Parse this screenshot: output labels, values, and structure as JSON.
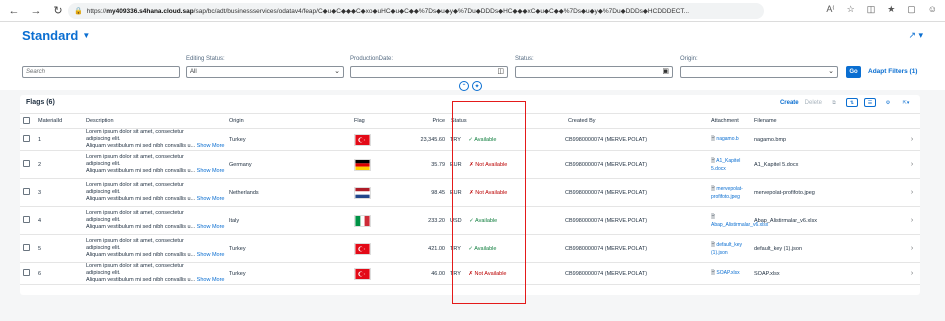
{
  "browser": {
    "url_host": "my409336.s4hana.cloud.sap",
    "url_path": "/sap/bc/adt/businessservices/odatav4/feap/C◆u◆C◆◆◆C◆xo◆uHC◆u◆C◆◆%7Ds◆u◆y◆%7Du◆DDDs◆HC◆◆◆xC◆u◆C◆◆%7Ds◆u◆y◆%7Du◆DDDs◆HCDDDECT..."
  },
  "header": {
    "title": "Standard"
  },
  "filters": {
    "search_placeholder": "Search",
    "editing_status_label": "Editing Status:",
    "editing_status_value": "All",
    "production_date_label": "ProductionDate:",
    "status_label": "Status:",
    "origin_label": "Origin:",
    "go_label": "Go",
    "adapt_label": "Adapt Filters (1)"
  },
  "table": {
    "title": "Flags (6)",
    "create_label": "Create",
    "delete_label": "Delete",
    "columns": [
      "MaterialId",
      "Description",
      "Origin",
      "Flag",
      "Price",
      "Status",
      "Created By",
      "Attachment",
      "Filename"
    ],
    "show_more": "Show More",
    "rows": [
      {
        "id": "1",
        "desc1": "Lorem ipsum dolor sit amet, consectetur",
        "desc2": "adipiscing elit.",
        "desc3": "Aliquam vestibulum mi sed nibh convallis u...",
        "origin": "Turkey",
        "flag": "turkey",
        "price": "23,345.60",
        "currency": "TRY",
        "status": "Available",
        "available": true,
        "created_by": "CB9980000074 (MERVE.POLAT)",
        "attachment": "nagamo.b",
        "filename": "nagamo.bmp"
      },
      {
        "id": "2",
        "desc1": "Lorem ipsum dolor sit amet, consectetur",
        "desc2": "adipiscing elit.",
        "desc3": "Aliquam vestibulum mi sed nibh convallis u...",
        "origin": "Germany",
        "flag": "germany",
        "price": "35.79",
        "currency": "EUR",
        "status": "Not Available",
        "available": false,
        "created_by": "CB9980000074 (MERVE.POLAT)",
        "attachment": "A1_Kapitel 5.docx",
        "filename": "A1_Kapitel 5.docx"
      },
      {
        "id": "3",
        "desc1": "Lorem ipsum dolor sit amet, consectetur",
        "desc2": "adipiscing elit.",
        "desc3": "Aliquam vestibulum mi sed nibh convallis u...",
        "origin": "Netherlands",
        "flag": "netherlands",
        "price": "98.45",
        "currency": "EUR",
        "status": "Not Available",
        "available": false,
        "created_by": "CB9980000074 (MERVE.POLAT)",
        "attachment": "mervepolat-profifoto.jpeg",
        "filename": "mervepolat-profifoto.jpeg"
      },
      {
        "id": "4",
        "desc1": "Lorem ipsum dolor sit amet, consectetur",
        "desc2": "adipiscing elit.",
        "desc3": "Aliquam vestibulum mi sed nibh convallis u...",
        "origin": "Italy",
        "flag": "italy",
        "price": "233.20",
        "currency": "USD",
        "status": "Available",
        "available": true,
        "created_by": "CB9980000074 (MERVE.POLAT)",
        "attachment": "Abap_Alistirmalar_v6.xlsx",
        "filename": "Abap_Alistirmalar_v6.xlsx"
      },
      {
        "id": "5",
        "desc1": "Lorem ipsum dolor sit amet, consectetur",
        "desc2": "adipiscing elit.",
        "desc3": "Aliquam vestibulum mi sed nibh convallis u...",
        "origin": "Turkey",
        "flag": "turkey",
        "price": "421.00",
        "currency": "TRY",
        "status": "Available",
        "available": true,
        "created_by": "CB9980000074 (MERVE.POLAT)",
        "attachment": "default_key (1).json",
        "filename": "default_key (1).json"
      },
      {
        "id": "6",
        "desc1": "Lorem ipsum dolor sit amet, consectetur",
        "desc2": "adipiscing elit.",
        "desc3": "Aliquam vestibulum mi sed nibh convallis u...",
        "origin": "Turkey",
        "flag": "turkey",
        "price": "46.00",
        "currency": "TRY",
        "status": "Not Available",
        "available": false,
        "created_by": "CB9980000074 (MERVE.POLAT)",
        "attachment": "SOAP.xlsx",
        "filename": "SOAP.xlsx"
      }
    ]
  }
}
